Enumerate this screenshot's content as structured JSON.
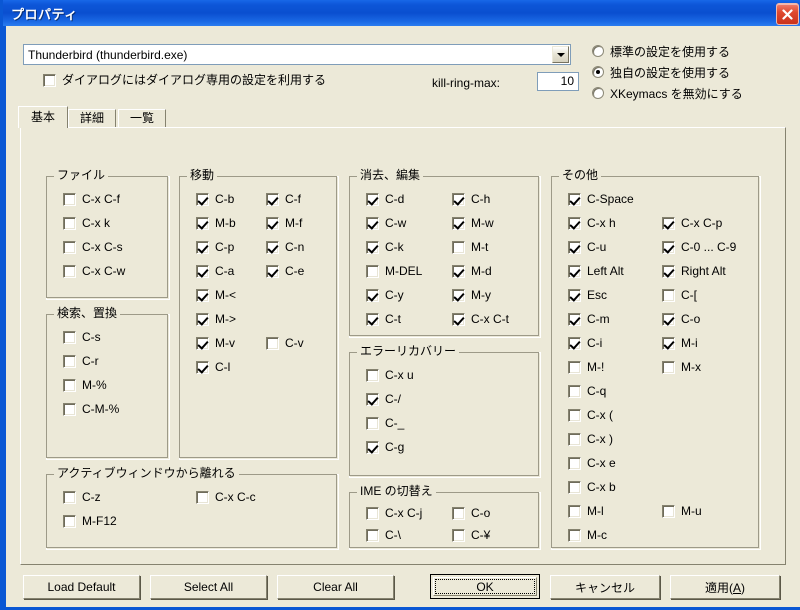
{
  "window": {
    "title": "プロパティ",
    "close_icon": "close-icon",
    "titlebar_color": "#0a4fd0",
    "panel_color": "#ece9d8"
  },
  "top": {
    "combo": {
      "value": "Thunderbird (thunderbird.exe)",
      "arrow_icon": "chevron-down-icon"
    },
    "dialog_checkbox": {
      "label": "ダイアログにはダイアログ専用の設定を利用する",
      "checked": false
    },
    "kill_ring_max": {
      "label": "kill-ring-max:",
      "value": "10"
    },
    "radios": [
      {
        "label": "標準の設定を使用する",
        "selected": false
      },
      {
        "label": "独自の設定を使用する",
        "selected": true
      },
      {
        "label": "XKeymacs を無効にする",
        "selected": false
      }
    ]
  },
  "tabs": [
    {
      "label": "基本",
      "selected": true
    },
    {
      "label": "詳細",
      "selected": false
    },
    {
      "label": "一覧",
      "selected": false
    }
  ],
  "groups": {
    "file": {
      "legend": "ファイル",
      "col1": [
        {
          "label": "C-x C-f",
          "checked": false
        },
        {
          "label": "C-x k",
          "checked": false
        },
        {
          "label": "C-x C-s",
          "checked": false
        },
        {
          "label": "C-x C-w",
          "checked": false
        }
      ],
      "col2": []
    },
    "search_replace": {
      "legend": "検索、置換",
      "col1": [
        {
          "label": "C-s",
          "checked": false
        },
        {
          "label": "C-r",
          "checked": false
        },
        {
          "label": "M-%",
          "checked": false
        },
        {
          "label": "C-M-%",
          "checked": false
        }
      ],
      "col2": []
    },
    "move": {
      "legend": "移動",
      "col1": [
        {
          "label": "C-b",
          "checked": true
        },
        {
          "label": "M-b",
          "checked": true
        },
        {
          "label": "C-p",
          "checked": true
        },
        {
          "label": "C-a",
          "checked": true
        },
        {
          "label": "M-<",
          "checked": true
        },
        {
          "label": "M->",
          "checked": true
        },
        {
          "label": "M-v",
          "checked": true
        },
        {
          "label": "C-l",
          "checked": true
        }
      ],
      "col2": [
        {
          "label": "C-f",
          "checked": true
        },
        {
          "label": "M-f",
          "checked": true
        },
        {
          "label": "C-n",
          "checked": true
        },
        {
          "label": "C-e",
          "checked": true
        },
        {
          "label": "",
          "checked": null
        },
        {
          "label": "",
          "checked": null
        },
        {
          "label": "C-v",
          "checked": false
        }
      ]
    },
    "leave_active_window": {
      "legend": "アクティブウィンドウから離れる",
      "col1": [
        {
          "label": "C-z",
          "checked": false
        },
        {
          "label": "M-F12",
          "checked": false
        }
      ],
      "col2": [
        {
          "label": "C-x C-c",
          "checked": false
        }
      ]
    },
    "erase_edit": {
      "legend": "消去、編集",
      "col1": [
        {
          "label": "C-d",
          "checked": true
        },
        {
          "label": "C-w",
          "checked": true
        },
        {
          "label": "C-k",
          "checked": true
        },
        {
          "label": "M-DEL",
          "checked": false
        },
        {
          "label": "C-y",
          "checked": true
        },
        {
          "label": "C-t",
          "checked": true
        }
      ],
      "col2": [
        {
          "label": "C-h",
          "checked": true
        },
        {
          "label": "M-w",
          "checked": true
        },
        {
          "label": "M-t",
          "checked": false
        },
        {
          "label": "M-d",
          "checked": true
        },
        {
          "label": "M-y",
          "checked": true
        },
        {
          "label": "C-x C-t",
          "checked": true
        }
      ]
    },
    "error_recovery": {
      "legend": "エラーリカバリー",
      "col1": [
        {
          "label": "C-x u",
          "checked": false
        },
        {
          "label": "C-/",
          "checked": true
        },
        {
          "label": "C-_",
          "checked": false
        },
        {
          "label": "C-g",
          "checked": true
        }
      ],
      "col2": []
    },
    "ime": {
      "legend": "IME の切替え",
      "col1": [
        {
          "label": "C-x C-j",
          "checked": false
        },
        {
          "label": "C-\\",
          "checked": false
        }
      ],
      "col2": [
        {
          "label": "C-o",
          "checked": false
        },
        {
          "label": "C-¥",
          "checked": false
        }
      ]
    },
    "other": {
      "legend": "その他",
      "col1": [
        {
          "label": "C-Space",
          "checked": true
        },
        {
          "label": "C-x h",
          "checked": true
        },
        {
          "label": "C-u",
          "checked": true
        },
        {
          "label": "Left Alt",
          "checked": true
        },
        {
          "label": "Esc",
          "checked": true
        },
        {
          "label": "C-m",
          "checked": true
        },
        {
          "label": "C-i",
          "checked": true
        },
        {
          "label": "M-!",
          "checked": false
        },
        {
          "label": "C-q",
          "checked": false
        },
        {
          "label": "C-x (",
          "checked": false
        },
        {
          "label": "C-x )",
          "checked": false
        },
        {
          "label": "C-x e",
          "checked": false
        },
        {
          "label": "C-x b",
          "checked": false
        },
        {
          "label": "M-l",
          "checked": false
        },
        {
          "label": "M-c",
          "checked": false
        }
      ],
      "col2": [
        {
          "label": "",
          "checked": null
        },
        {
          "label": "C-x C-p",
          "checked": true
        },
        {
          "label": "C-0 ... C-9",
          "checked": true
        },
        {
          "label": "Right Alt",
          "checked": true
        },
        {
          "label": "C-[",
          "checked": false
        },
        {
          "label": "C-o",
          "checked": true
        },
        {
          "label": "M-i",
          "checked": true
        },
        {
          "label": "M-x",
          "checked": false
        },
        {
          "label": "",
          "checked": null
        },
        {
          "label": "",
          "checked": null
        },
        {
          "label": "",
          "checked": null
        },
        {
          "label": "",
          "checked": null
        },
        {
          "label": "",
          "checked": null
        },
        {
          "label": "M-u",
          "checked": false
        }
      ]
    }
  },
  "buttons": {
    "load_default": "Load Default",
    "select_all": "Select All",
    "clear_all": "Clear All",
    "ok": "OK",
    "cancel": "キャンセル",
    "apply": "適用(A)"
  }
}
